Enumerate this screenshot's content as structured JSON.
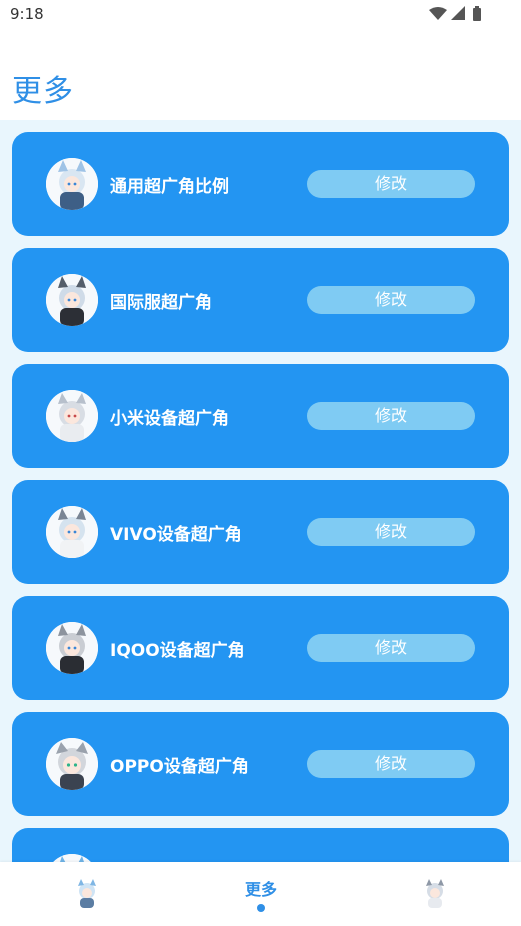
{
  "status_bar": {
    "time": "9:18"
  },
  "header": {
    "title": "更多"
  },
  "cards": [
    {
      "label": "通用超广角比例",
      "button": "修改"
    },
    {
      "label": "国际服超广角",
      "button": "修改"
    },
    {
      "label": "小米设备超广角",
      "button": "修改"
    },
    {
      "label": "VIVO设备超广角",
      "button": "修改"
    },
    {
      "label": "IQOO设备超广角",
      "button": "修改"
    },
    {
      "label": "OPPO设备超广角",
      "button": "修改"
    }
  ],
  "bottom_nav": {
    "active_label": "更多"
  },
  "colors": {
    "accent": "#2f8fe6",
    "card": "#2395f2",
    "button": "#7fcbf3",
    "content_bg": "#e9f6fd"
  }
}
